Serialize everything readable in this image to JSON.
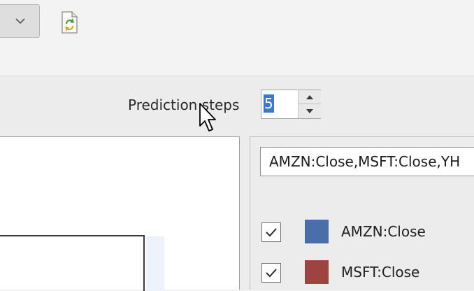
{
  "toolbar": {
    "combo_icon": "chevron-down-icon",
    "refresh_icon": "refresh-document-icon"
  },
  "prediction": {
    "label": "Prediction steps",
    "value": "5"
  },
  "series_panel": {
    "field_value": "AMZN:Close,MSFT:Close,YH",
    "items": [
      {
        "label": "AMZN:Close",
        "checked": true,
        "color": "#4a6fa8"
      },
      {
        "label": "MSFT:Close",
        "checked": true,
        "color": "#9e4440"
      }
    ]
  },
  "colors": {
    "selection": "#3a78d4",
    "window_bg": "#f0f0f0"
  }
}
